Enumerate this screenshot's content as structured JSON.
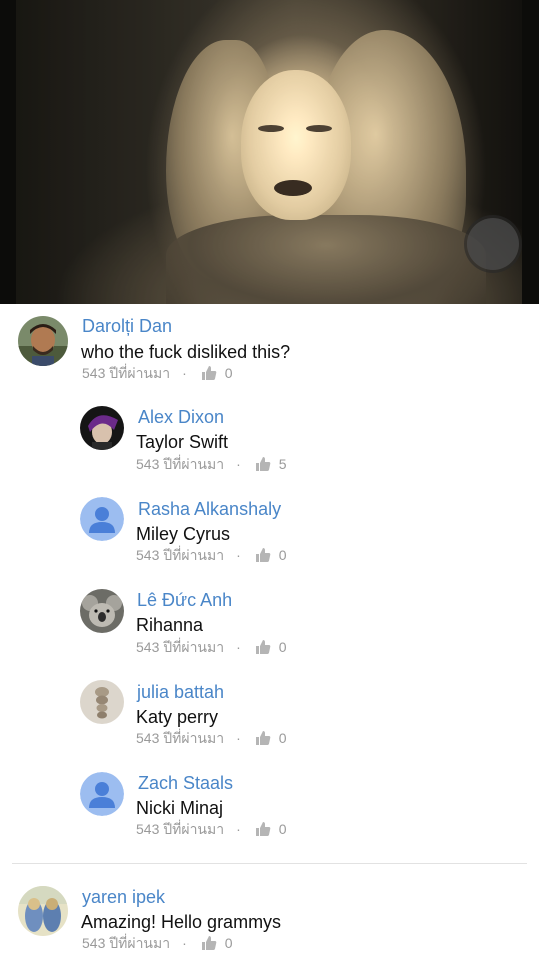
{
  "video": {
    "control_icon": "circle-button-icon"
  },
  "comments": [
    {
      "author": "Darolți Dan",
      "text": "who the fuck disliked this?",
      "time": "543 ปีที่ผ่านมา",
      "separator": "·",
      "likes": "0",
      "avatar": "photo-avatar-man"
    },
    {
      "author": "Alex Dixon",
      "text": "Taylor Swift",
      "time": "543 ปีที่ผ่านมา",
      "separator": "·",
      "likes": "5",
      "avatar": "photo-avatar-dark"
    },
    {
      "author": "Rasha Alkanshaly",
      "text": "Miley Cyrus",
      "time": "543 ปีที่ผ่านมา",
      "separator": "·",
      "likes": "0",
      "avatar": "default-user-avatar"
    },
    {
      "author": "Lê Đức Anh",
      "text": "Rihanna",
      "time": "543 ปีที่ผ่านมา",
      "separator": "·",
      "likes": "0",
      "avatar": "photo-avatar-koala"
    },
    {
      "author": "julia battah",
      "text": "Katy perry",
      "time": "543 ปีที่ผ่านมา",
      "separator": "·",
      "likes": "0",
      "avatar": "photo-avatar-braid"
    },
    {
      "author": "Zach Staals",
      "text": "Nicki Minaj",
      "time": "543 ปีที่ผ่านมา",
      "separator": "·",
      "likes": "0",
      "avatar": "default-user-avatar"
    },
    {
      "author": "yaren ipek",
      "text": "Amazing! Hello grammys",
      "time": "543 ปีที่ผ่านมา",
      "separator": "·",
      "likes": "0",
      "avatar": "photo-avatar-group"
    }
  ],
  "colors": {
    "author_link": "#4a86c8",
    "comment_text": "#111111",
    "meta_text": "#9a9a9a",
    "default_avatar_bg": "#9cbdf0",
    "default_avatar_fg": "#4a7fd8"
  }
}
